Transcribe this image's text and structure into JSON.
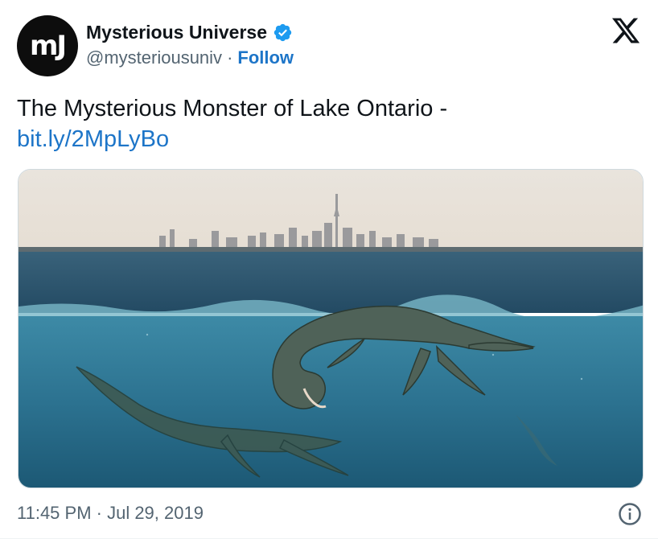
{
  "account": {
    "avatar_text": "mJ",
    "display_name": "Mysterious Universe",
    "handle": "@mysteriousuniv",
    "separator": "·",
    "follow_label": "Follow",
    "verified_icon": "verified-badge-icon"
  },
  "platform_icon": "x-logo-icon",
  "tweet": {
    "text": "The Mysterious Monster of Lake Ontario -",
    "link_text": "bit.ly/2MpLyBo"
  },
  "media": {
    "description_icon": "lake-monster-image"
  },
  "footer": {
    "timestamp": "11:45 PM · Jul 29, 2019",
    "info_icon": "info-icon"
  },
  "colors": {
    "link": "#1d75c8",
    "secondary_text": "#536471",
    "verified": "#1d9bf0",
    "primary_text": "#0f1419"
  }
}
